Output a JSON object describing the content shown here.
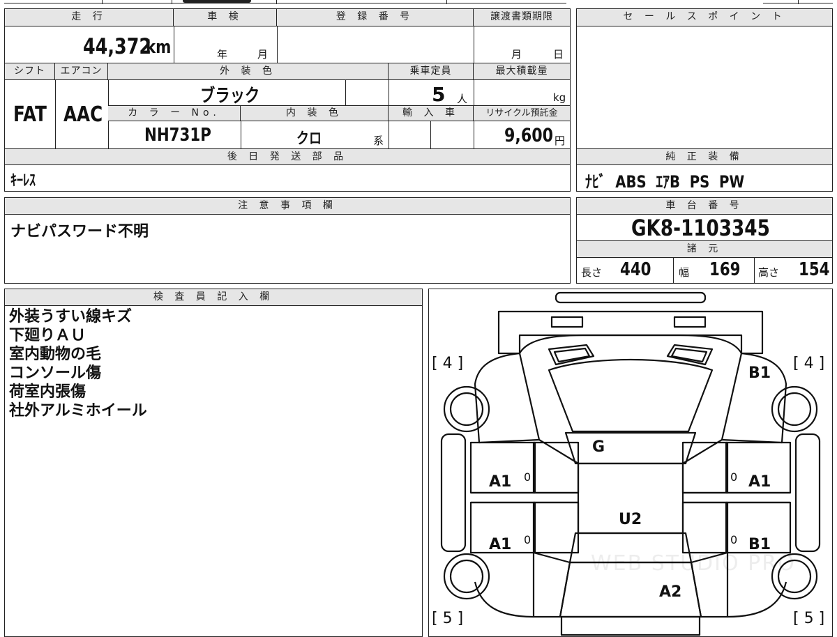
{
  "spec": {
    "mileage_header": "走 行",
    "mileage": "44,372",
    "mileage_unit": "km",
    "shaken_header": "車 検",
    "shaken_year_unit": "年",
    "shaken_month_unit": "月",
    "reg_header": "登 録 番 号",
    "transfer_header": "譲渡書類期限",
    "transfer_month_unit": "月",
    "transfer_day_unit": "日",
    "shift_header": "シフト",
    "shift": "FAT",
    "ac_header": "エアコン",
    "ac": "AAC",
    "exterior_color_header": "外 装 色",
    "exterior_color": "ブラック",
    "capacity_header": "乗車定員",
    "capacity": "5",
    "capacity_unit": "人",
    "max_load_header": "最大積載量",
    "max_load_unit": "kg",
    "color_no_header": "カ ラ ー No.",
    "color_no": "NH731P",
    "interior_color_header": "内 装 色",
    "interior_color": "クロ",
    "interior_suffix": "系",
    "import_header": "輸 入 車",
    "recycle_header": "リサイクル預託金",
    "recycle": "9,600",
    "recycle_unit": "円"
  },
  "sales_point": {
    "header": "セ ー ル ス ポ イ ン ト"
  },
  "later_parts": {
    "header": "後 日 発 送 部 品",
    "value": "ｷｰﾚｽ"
  },
  "equipment": {
    "header": "純 正 装 備",
    "value": "ﾅﾋﾞ  ABS  ｴｱB  PS  PW"
  },
  "caution": {
    "header": "注 意 事 項 欄",
    "value": "ナビパスワード不明"
  },
  "chassis": {
    "header": "車 台 番 号",
    "value": "GK8-1103345"
  },
  "dimensions": {
    "header": "諸 元",
    "length_label": "長さ",
    "length": "440",
    "width_label": "幅",
    "width": "169",
    "height_label": "高さ",
    "height": "154"
  },
  "inspector": {
    "header": "検 査 員 記 入 欄",
    "notes": [
      "外装うすい線キズ",
      "下廻りＡＵ",
      "室内動物の毛",
      "コンソール傷",
      "荷室内張傷",
      "社外アルミホイール"
    ]
  },
  "diagram": {
    "tire_front_left": "[ 4 ]",
    "tire_front_right": "[ 4 ]",
    "tire_rear_left": "[ 5 ]",
    "tire_rear_right": "[ 5 ]",
    "front_right_fender": "B1",
    "windshield": "G",
    "front_door_left": "A1",
    "front_door_right": "A1",
    "rear_door_left": "A1",
    "rear_door_right": "B1",
    "roof": "U2",
    "rear": "A2",
    "door_mark_left_front": "0",
    "door_mark_right_front": "0",
    "door_mark_left_rear": "0",
    "door_mark_right_rear": "0",
    "watermark": "WEB STUDIO PRO"
  }
}
